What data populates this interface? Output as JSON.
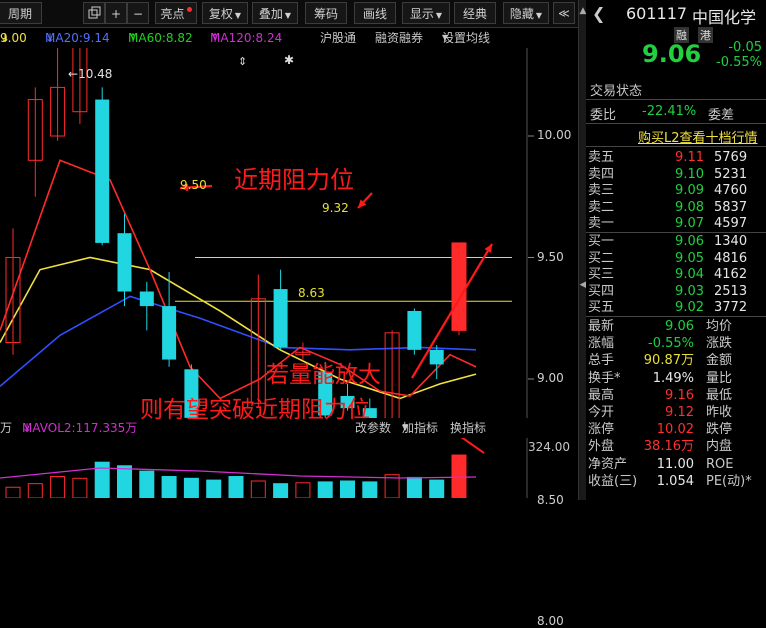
{
  "toolbar": {
    "period_label": "周期",
    "icon_add": "+",
    "icon_minus": "−",
    "highlight_label": "亮点",
    "restore_label": "复权",
    "overlay_label": "叠加",
    "chip_label": "筹码",
    "draw_label": "画线",
    "display_label": "显示",
    "classic_label": "经典",
    "hide_label": "隐藏"
  },
  "ma_bar": {
    "first": "9.00",
    "ma20": "MA20:9.14",
    "ma60": "MA60:8.82",
    "ma120": "MA120:8.24",
    "link1": "沪股通",
    "link2": "融资融券",
    "link3": "设置均线"
  },
  "price_labels": {
    "high": "10.48",
    "r1": "9.50",
    "r2": "9.32",
    "s1": "8.63"
  },
  "annotations": {
    "resistance": "近期阻力位",
    "volume": "若量能放大",
    "breakout": "则有望突破近期阻力位"
  },
  "vol_bar": {
    "unit": "万",
    "mavol2": "MAVOL2:117.335万",
    "params": "改参数",
    "add_indicator": "加指标",
    "switch_indicator": "换指标",
    "vol_axis": "324.00"
  },
  "colors": {
    "up": "#ff2a2a",
    "down": "#21d6e0",
    "ma5": "#ff2a2a",
    "ma10": "#f0e040",
    "ma20": "#3050ff",
    "ma60": "#20d020",
    "ma120": "#c020c0"
  },
  "chart_data": {
    "type": "candlestick",
    "y_ticks": [
      "10.00",
      "9.50",
      "9.00",
      "8.50",
      "8.00"
    ],
    "candles": [
      {
        "o": 9.5,
        "c": 9.15,
        "h": 9.62,
        "l": 9.1,
        "dir": "up"
      },
      {
        "o": 9.9,
        "c": 10.15,
        "h": 10.2,
        "l": 9.75,
        "dir": "up"
      },
      {
        "o": 10.0,
        "c": 10.2,
        "h": 10.48,
        "l": 9.98,
        "dir": "up"
      },
      {
        "o": 10.4,
        "c": 10.1,
        "h": 10.48,
        "l": 10.05,
        "dir": "up"
      },
      {
        "o": 10.15,
        "c": 9.56,
        "h": 10.2,
        "l": 9.55,
        "dir": "down"
      },
      {
        "o": 9.6,
        "c": 9.36,
        "h": 9.68,
        "l": 9.3,
        "dir": "down"
      },
      {
        "o": 9.36,
        "c": 9.3,
        "h": 9.4,
        "l": 9.2,
        "dir": "down"
      },
      {
        "o": 9.3,
        "c": 9.08,
        "h": 9.44,
        "l": 9.05,
        "dir": "down"
      },
      {
        "o": 9.04,
        "c": 8.84,
        "h": 9.06,
        "l": 8.82,
        "dir": "down"
      },
      {
        "o": 8.68,
        "c": 8.65,
        "h": 8.75,
        "l": 8.63,
        "dir": "down"
      },
      {
        "o": 8.7,
        "c": 8.75,
        "h": 8.77,
        "l": 8.51,
        "dir": "down"
      },
      {
        "o": 8.9,
        "c": 9.33,
        "h": 9.43,
        "l": 8.88,
        "dir": "up"
      },
      {
        "o": 9.37,
        "c": 9.13,
        "h": 9.45,
        "l": 9.12,
        "dir": "down"
      },
      {
        "o": 9.1,
        "c": 9.11,
        "h": 9.15,
        "l": 9.08,
        "dir": "up"
      },
      {
        "o": 9.03,
        "c": 8.85,
        "h": 9.07,
        "l": 8.84,
        "dir": "down"
      },
      {
        "o": 8.93,
        "c": 8.88,
        "h": 8.98,
        "l": 8.87,
        "dir": "down"
      },
      {
        "o": 8.88,
        "c": 8.74,
        "h": 8.92,
        "l": 8.67,
        "dir": "down"
      },
      {
        "o": 8.76,
        "c": 9.19,
        "h": 9.2,
        "l": 8.76,
        "dir": "up"
      },
      {
        "o": 9.28,
        "c": 9.12,
        "h": 9.29,
        "l": 9.1,
        "dir": "down"
      },
      {
        "o": 9.12,
        "c": 9.06,
        "h": 9.14,
        "l": 9.0,
        "dir": "down"
      },
      {
        "o": 9.2,
        "c": 9.56,
        "h": 9.56,
        "l": 9.18,
        "dir": "up"
      }
    ],
    "volumes": [
      60,
      80,
      120,
      110,
      200,
      180,
      150,
      120,
      110,
      100,
      120,
      95,
      80,
      85,
      90,
      95,
      90,
      130,
      115,
      100,
      240
    ],
    "volume_ylim": [
      0,
      324
    ]
  },
  "stock": {
    "code": "601117",
    "name": "中国化学",
    "tag1": "融",
    "tag2": "港",
    "price": "9.06",
    "change": "-0.05",
    "change_pct": "-0.55%",
    "trade_status_label": "交易状态",
    "weibi_label": "委比",
    "weibi_value": "-22.41%",
    "weicha_label": "委差",
    "l2_link": "购买L2查看十档行情"
  },
  "order_book": {
    "sells": [
      {
        "label": "卖五",
        "price": "9.11",
        "vol": "5769"
      },
      {
        "label": "卖四",
        "price": "9.10",
        "vol": "5231"
      },
      {
        "label": "卖三",
        "price": "9.09",
        "vol": "4760"
      },
      {
        "label": "卖二",
        "price": "9.08",
        "vol": "5837"
      },
      {
        "label": "卖一",
        "price": "9.07",
        "vol": "4597"
      }
    ],
    "buys": [
      {
        "label": "买一",
        "price": "9.06",
        "vol": "1340"
      },
      {
        "label": "买二",
        "price": "9.05",
        "vol": "4816"
      },
      {
        "label": "买三",
        "price": "9.04",
        "vol": "4162"
      },
      {
        "label": "买四",
        "price": "9.03",
        "vol": "2513"
      },
      {
        "label": "买五",
        "price": "9.02",
        "vol": "3772"
      }
    ]
  },
  "quote": [
    {
      "l1": "最新",
      "v1": "9.06",
      "c1": "green",
      "l2": "均价"
    },
    {
      "l1": "涨幅",
      "v1": "-0.55%",
      "c1": "green",
      "l2": "涨跌"
    },
    {
      "l1": "总手",
      "v1": "90.87万",
      "c1": "yellow",
      "l2": "金额"
    },
    {
      "l1": "换手*",
      "v1": "1.49%",
      "c1": "white",
      "l2": "量比"
    },
    {
      "l1": "最高",
      "v1": "9.16",
      "c1": "red",
      "l2": "最低"
    },
    {
      "l1": "今开",
      "v1": "9.12",
      "c1": "red",
      "l2": "昨收"
    },
    {
      "l1": "涨停",
      "v1": "10.02",
      "c1": "red",
      "l2": "跌停"
    },
    {
      "l1": "外盘",
      "v1": "38.16万",
      "c1": "red",
      "l2": "内盘"
    },
    {
      "l1": "净资产",
      "v1": "11.00",
      "c1": "white",
      "l2": "ROE"
    },
    {
      "l1": "收益(三)",
      "v1": "1.054",
      "c1": "white",
      "l2": "PE(动)*"
    }
  ]
}
